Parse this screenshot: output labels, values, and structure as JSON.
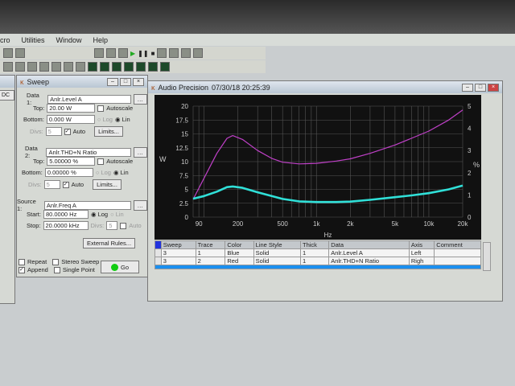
{
  "menu": [
    "cro",
    "Utilities",
    "Window",
    "Help"
  ],
  "left_window": {
    "label": "DC"
  },
  "sweep": {
    "title": "Sweep",
    "data1": {
      "label": "Data 1:",
      "value": "Anlr.Level A",
      "top_label": "Top:",
      "top": "20.00",
      "top_unit": "W",
      "bottom_label": "Bottom:",
      "bottom": "0.000",
      "bottom_unit": "W",
      "autoscale": "Autoscale",
      "log": "Log",
      "lin": "Lin",
      "divs_label": "Divs:",
      "divs": "5",
      "auto": "Auto",
      "limits": "Limits..."
    },
    "data2": {
      "label": "Data 2:",
      "value": "Anlr.THD+N Ratio",
      "top_label": "Top:",
      "top": "5.00000",
      "top_unit": "%",
      "bottom_label": "Bottom:",
      "bottom": "0.00000",
      "bottom_unit": "%",
      "autoscale": "Autoscale",
      "log": "Log",
      "lin": "Lin",
      "divs_label": "Divs:",
      "divs": "5",
      "auto": "Auto",
      "limits": "Limits..."
    },
    "source1": {
      "label": "Source 1:",
      "value": "Anlr.Freq A",
      "start_label": "Start:",
      "start": "80.0000",
      "start_unit": "Hz",
      "stop_label": "Stop:",
      "stop": "20.0000",
      "stop_unit": "kHz",
      "log": "Log",
      "lin": "Lin",
      "divs_label": "Divs:",
      "divs": "5",
      "auto": "Auto"
    },
    "external_rules": "External Rules...",
    "repeat": "Repeat",
    "stereo_sweep": "Stereo Sweep",
    "append": "Append",
    "single_point": "Single Point",
    "go": "Go"
  },
  "graph": {
    "title": "Audio Precision",
    "timestamp": "07/30/18 20:25:39",
    "table": {
      "headers": [
        "Sweep",
        "Trace",
        "Color",
        "Line Style",
        "Thick",
        "Data",
        "Axis",
        "Comment"
      ],
      "rows": [
        [
          "3",
          "1",
          "Blue",
          "Solid",
          "1",
          "Anlr.Level A",
          "Left",
          ""
        ],
        [
          "3",
          "2",
          "Red",
          "Solid",
          "1",
          "Anlr.THD+N Ratio",
          "Righ",
          ""
        ]
      ]
    }
  },
  "chart_data": {
    "type": "line",
    "xlabel": "Hz",
    "ylabel": "W",
    "y2label": "%",
    "xscale": "log",
    "xlim": [
      80,
      20000
    ],
    "ylim": [
      0,
      20
    ],
    "y2lim": [
      0,
      5
    ],
    "xticks": [
      {
        "v": 90,
        "l": "90"
      },
      {
        "v": 200,
        "l": "200"
      },
      {
        "v": 500,
        "l": "500"
      },
      {
        "v": 1000,
        "l": "1k"
      },
      {
        "v": 2000,
        "l": "2k"
      },
      {
        "v": 5000,
        "l": "5k"
      },
      {
        "v": 10000,
        "l": "10k"
      },
      {
        "v": 20000,
        "l": "20k"
      }
    ],
    "yticks": [
      "0",
      "2.5",
      "5",
      "7.5",
      "10",
      "12.5",
      "15",
      "17.5",
      "20"
    ],
    "y2ticks": [
      "0",
      "1",
      "2",
      "3",
      "4",
      "5"
    ],
    "grid": true,
    "series": [
      {
        "name": "Anlr.Level A",
        "axis": "left",
        "color": "#c040c8",
        "x": [
          80,
          100,
          130,
          160,
          180,
          220,
          300,
          400,
          500,
          700,
          1000,
          1500,
          2000,
          3000,
          5000,
          7000,
          10000,
          15000,
          20000
        ],
        "y": [
          3.2,
          7,
          11.5,
          14.2,
          14.7,
          14,
          12,
          10.6,
          9.9,
          9.6,
          9.7,
          10.1,
          10.5,
          11.5,
          13,
          14.2,
          15.5,
          17.5,
          19.3
        ]
      },
      {
        "name": "Anlr.THD+N Ratio",
        "axis": "right",
        "color": "#30e0d8",
        "x": [
          80,
          100,
          130,
          160,
          180,
          220,
          300,
          400,
          500,
          700,
          1000,
          1500,
          2000,
          3000,
          5000,
          7000,
          10000,
          15000,
          20000
        ],
        "y": [
          0.83,
          0.95,
          1.15,
          1.35,
          1.38,
          1.32,
          1.12,
          0.95,
          0.82,
          0.71,
          0.68,
          0.68,
          0.7,
          0.78,
          0.9,
          0.98,
          1.08,
          1.25,
          1.42
        ]
      }
    ]
  }
}
